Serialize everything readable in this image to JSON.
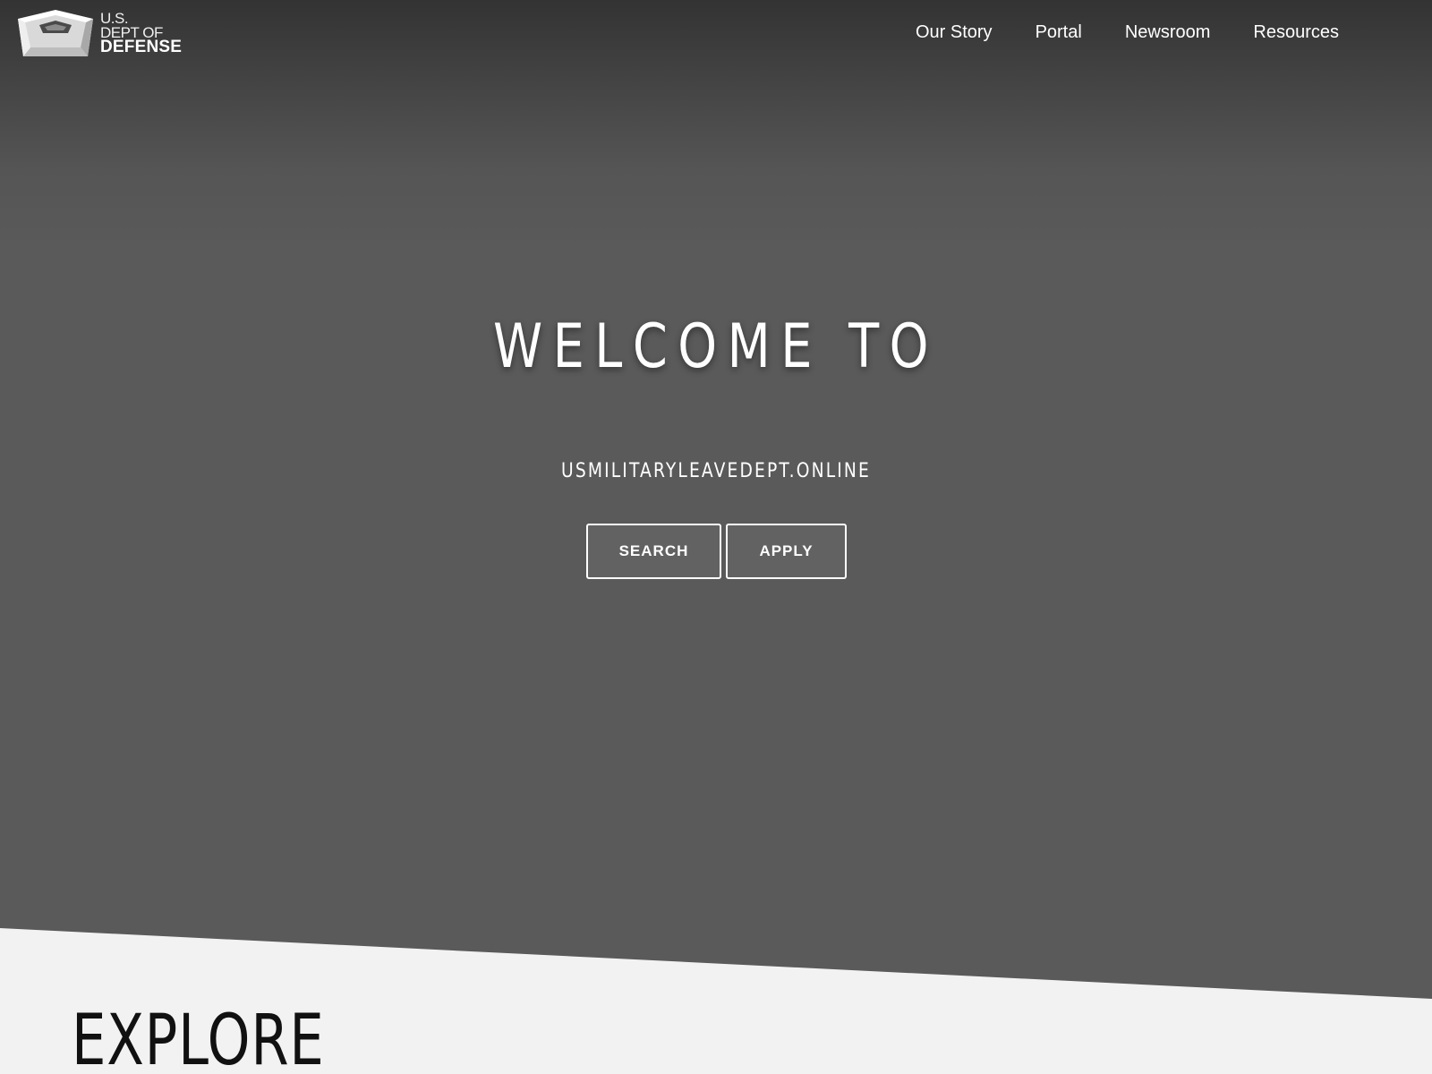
{
  "header": {
    "logo": {
      "line1": "U.S.",
      "line2": "DEPT OF",
      "line3": "DEFENSE"
    },
    "nav": [
      {
        "label": "Our Story"
      },
      {
        "label": "Portal"
      },
      {
        "label": "Newsroom"
      },
      {
        "label": "Resources"
      }
    ]
  },
  "hero": {
    "title": "WELCOME TO",
    "subtitle": "USMILITARYLEAVEDEPT.ONLINE",
    "buttons": {
      "search_label": "SEARCH",
      "apply_label": "APPLY"
    }
  },
  "explore": {
    "title": "EXPLORE"
  },
  "colors": {
    "hero_bg": "#5a5a5a",
    "header_top": "#333333",
    "lower_bg": "#f2f2f2",
    "button_bg": "#626262",
    "text_light": "#ffffff",
    "text_dark": "#111111"
  }
}
